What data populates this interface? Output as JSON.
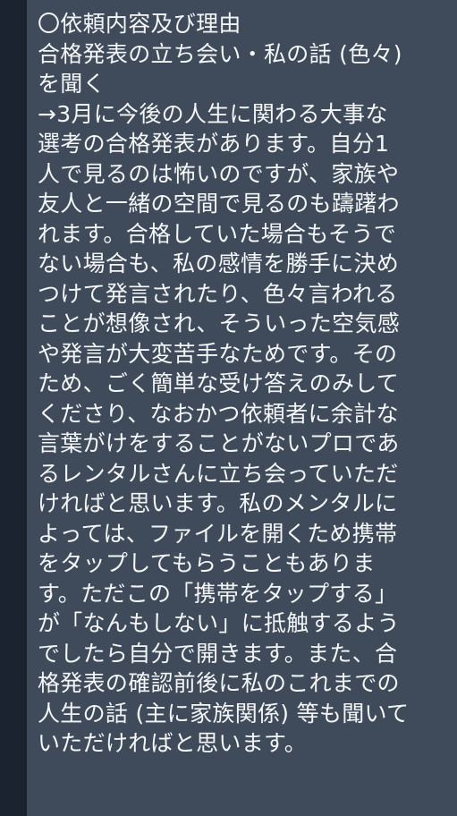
{
  "message": {
    "lines": [
      "〇依頼内容及び理由",
      "合格発表の立ち会い・私の話 (色々)",
      "を聞く",
      "→3月に今後の人生に関わる大事な",
      "選考の合格発表があります。自分1",
      "人で見るのは怖いのですが、家族や",
      "友人と一緒の空間で見るのも躊躇わ",
      "れます。合格していた場合もそうで",
      "ない場合も、私の感情を勝手に決め",
      "つけて発言されたり、色々言われる",
      "ことが想像され、そういった空気感",
      "や発言が大変苦手なためです。その",
      "ため、ごく簡単な受け答えのみして",
      "くださり、なおかつ依頼者に余計な",
      "言葉がけをすることがないプロであ",
      "るレンタルさんに立ち会っていただ",
      "ければと思います。私のメンタルに",
      "よっては、ファイルを開くため携帯",
      "をタップしてもらうこともありま",
      "す。ただこの「携帯をタップする」",
      "が「なんもしない」に抵触するよう",
      "でしたら自分で開きます。また、合",
      "格発表の確認前後に私のこれまでの",
      "人生の話 (主に家族関係) 等も聞いて",
      "いただければと思います。"
    ]
  }
}
